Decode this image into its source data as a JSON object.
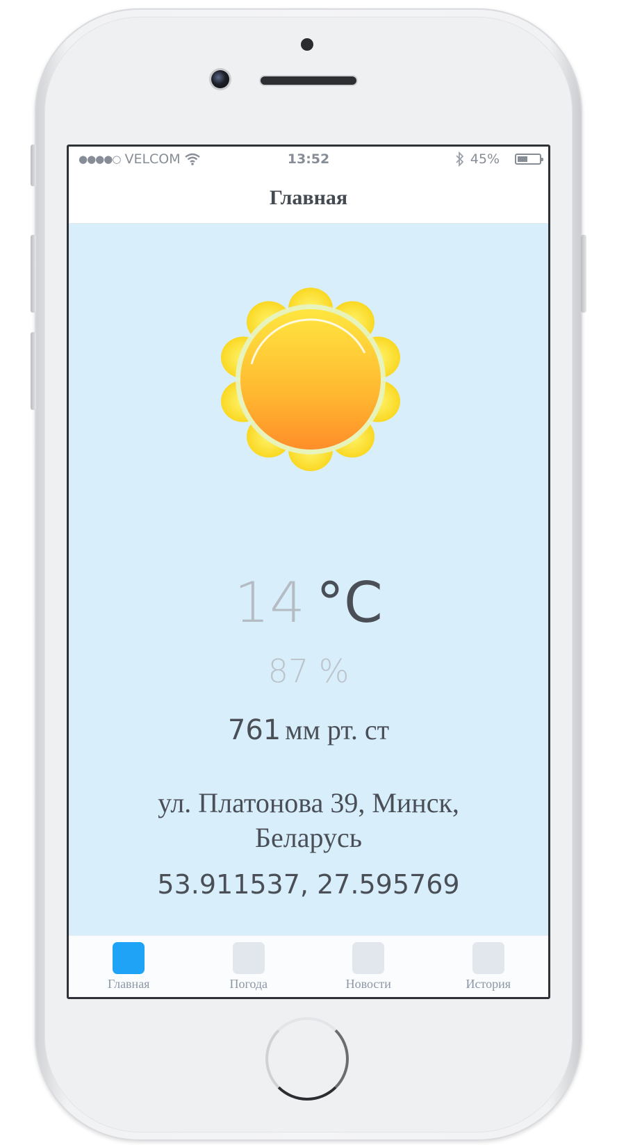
{
  "status_bar": {
    "signal": "●●●●○",
    "carrier": "VELCOM",
    "time": "13:52",
    "battery_percent": "45%",
    "battery_level": 0.45
  },
  "nav": {
    "title": "Главная"
  },
  "weather": {
    "temperature": "14",
    "temperature_unit": "°C",
    "humidity": "87 %",
    "pressure_value": "761",
    "pressure_unit": "мм рт. ст",
    "address": "ул. Платонова 39, Минск, Беларусь",
    "coordinates": "53.911537, 27.595769",
    "icon": "sun-icon"
  },
  "tabs": [
    {
      "label": "Главная",
      "active": true
    },
    {
      "label": "Погода",
      "active": false
    },
    {
      "label": "Новости",
      "active": false
    },
    {
      "label": "История",
      "active": false
    }
  ],
  "colors": {
    "screen_background": "#d8eefb",
    "tab_active": "#1ea3f7",
    "tab_inactive": "#e2e7ee",
    "text_dark": "#4a4f57"
  }
}
